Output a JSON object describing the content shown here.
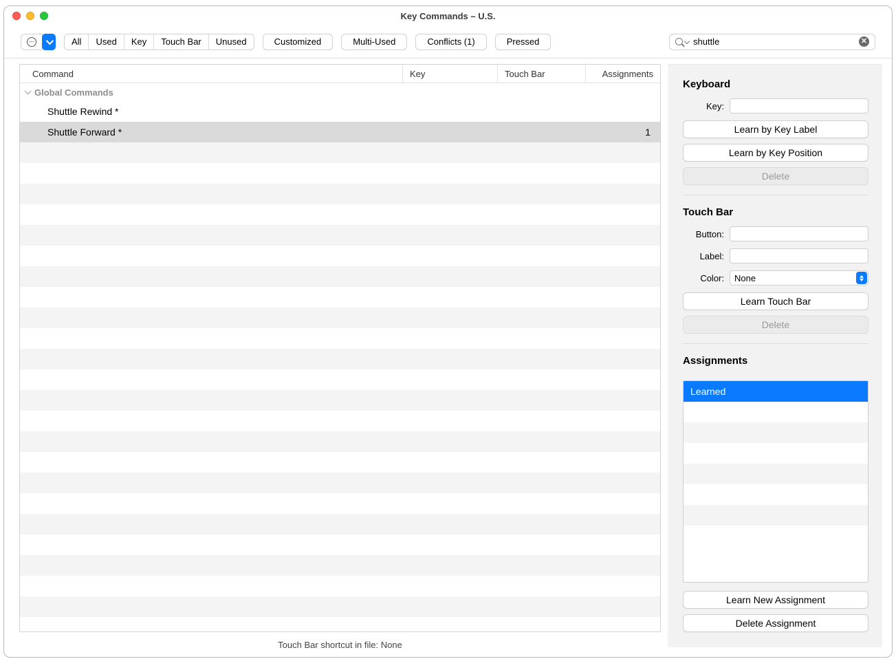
{
  "window": {
    "title": "Key Commands – U.S."
  },
  "toolbar": {
    "filters": {
      "all": "All",
      "used": "Used",
      "key": "Key",
      "touch_bar": "Touch Bar",
      "unused": "Unused"
    },
    "customized": "Customized",
    "multi_used": "Multi-Used",
    "conflicts": "Conflicts (1)",
    "pressed": "Pressed"
  },
  "search": {
    "value": "shuttle"
  },
  "table": {
    "headers": {
      "command": "Command",
      "key": "Key",
      "touch_bar": "Touch Bar",
      "assignments": "Assignments"
    },
    "group": "Global Commands",
    "rows": [
      {
        "command": "Shuttle Rewind *",
        "key": "",
        "touch_bar": "",
        "assignments": ""
      },
      {
        "command": "Shuttle Forward *",
        "key": "",
        "touch_bar": "",
        "assignments": "1"
      }
    ]
  },
  "statusbar": {
    "text": "Touch Bar shortcut in file: None"
  },
  "inspector": {
    "keyboard": {
      "title": "Keyboard",
      "key_label": "Key:",
      "key_value": "",
      "learn_label": "Learn by Key Label",
      "learn_position": "Learn by Key Position",
      "delete": "Delete"
    },
    "touchbar": {
      "title": "Touch Bar",
      "button_label": "Button:",
      "button_value": "",
      "label_label": "Label:",
      "label_value": "",
      "color_label": "Color:",
      "color_value": "None",
      "learn": "Learn Touch Bar",
      "delete": "Delete"
    },
    "assignments": {
      "title": "Assignments",
      "items": [
        "Learned"
      ],
      "learn_new": "Learn New Assignment",
      "delete": "Delete Assignment"
    }
  }
}
